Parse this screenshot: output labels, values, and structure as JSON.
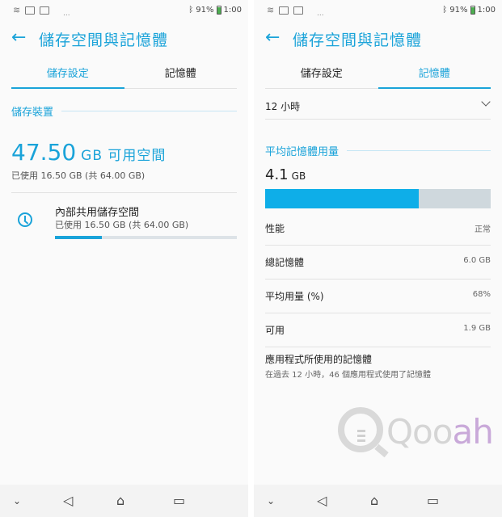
{
  "status": {
    "battery": "91%",
    "time": "1:00",
    "more": "..."
  },
  "left": {
    "title": "儲存空間與記憶體",
    "tabs": [
      "儲存設定",
      "記憶體"
    ],
    "section": "儲存裝置",
    "free_value": "47.50",
    "free_unit": "GB 可用空間",
    "used_summary": "已使用 16.50 GB (共 64.00 GB)",
    "item": {
      "title": "內部共用儲存空間",
      "subtitle": "已使用 16.50 GB (共 64.00 GB)",
      "used_fraction": 0.258
    }
  },
  "right": {
    "title": "儲存空間與記憶體",
    "tabs": [
      "儲存設定",
      "記憶體"
    ],
    "period": "12 小時",
    "section": "平均記憶體用量",
    "avg_value": "4.1",
    "avg_unit": "GB",
    "avg_fraction": 0.68,
    "rows": [
      {
        "label": "性能",
        "value": "正常"
      },
      {
        "label": "總記憶體",
        "value": "6.0 GB"
      },
      {
        "label": "平均用量 (%)",
        "value": "68%"
      },
      {
        "label": "可用",
        "value": "1.9 GB"
      }
    ],
    "apps_title": "應用程式所使用的記憶體",
    "apps_subtitle": "在過去 12 小時，46 個應用程式使用了記憶體"
  },
  "watermark": {
    "text_a": "Qoo",
    "text_b": "ah"
  },
  "colors": {
    "accent": "#1aa3d9",
    "bar_fill": "#0eaee8",
    "bar_track": "#cfd8dd"
  }
}
